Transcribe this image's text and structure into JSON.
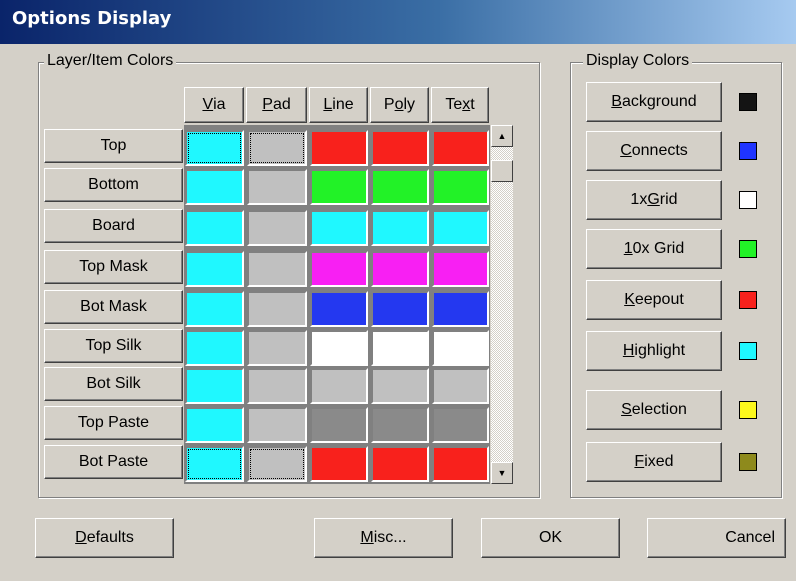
{
  "window": {
    "title": "Options Display"
  },
  "layer_group": {
    "title": "Layer/Item Colors",
    "columns": [
      {
        "pre": "",
        "ul": "V",
        "post": "ia"
      },
      {
        "pre": "",
        "ul": "P",
        "post": "ad"
      },
      {
        "pre": "",
        "ul": "L",
        "post": "ine"
      },
      {
        "pre": "P",
        "ul": "o",
        "post": "ly"
      },
      {
        "pre": "Te",
        "ul": "x",
        "post": "t"
      }
    ],
    "rows": [
      {
        "label": "Top",
        "colors": [
          "#1ff8ff",
          "#c0c0c0",
          "#f8211c",
          "#f8211c",
          "#f8211c"
        ]
      },
      {
        "label": "Bottom",
        "colors": [
          "#1ff8ff",
          "#c0c0c0",
          "#22f227",
          "#22f227",
          "#22f227"
        ]
      },
      {
        "label": "Board",
        "colors": [
          "#1ff8ff",
          "#c0c0c0",
          "#1ff8ff",
          "#1ff8ff",
          "#1ff8ff"
        ]
      },
      {
        "label": "Top Mask",
        "colors": [
          "#1ff8ff",
          "#c0c0c0",
          "#f81ff3",
          "#f81ff3",
          "#f81ff3"
        ]
      },
      {
        "label": "Bot Mask",
        "colors": [
          "#1ff8ff",
          "#c0c0c0",
          "#2438f0",
          "#2438f0",
          "#2438f0"
        ]
      },
      {
        "label": "Top Silk",
        "colors": [
          "#1ff8ff",
          "#c0c0c0",
          "#ffffff",
          "#ffffff",
          "#ffffff"
        ]
      },
      {
        "label": "Bot Silk",
        "colors": [
          "#1ff8ff",
          "#c0c0c0",
          "#c0c0c0",
          "#c0c0c0",
          "#c0c0c0"
        ]
      },
      {
        "label": "Top Paste",
        "colors": [
          "#1ff8ff",
          "#c0c0c0",
          "#8a8a8a",
          "#8a8a8a",
          "#8a8a8a"
        ]
      },
      {
        "label": "Bot Paste",
        "colors": [
          "#1ff8ff",
          "#c0c0c0",
          "#f8211c",
          "#f8211c",
          "#f8211c"
        ]
      }
    ]
  },
  "display_group": {
    "title": "Display Colors",
    "items": [
      {
        "pre": "",
        "ul": "B",
        "post": "ackground",
        "color": "#141414"
      },
      {
        "pre": "",
        "ul": "C",
        "post": "onnects",
        "color": "#1f34ff"
      },
      {
        "pre": "1x ",
        "ul": "G",
        "post": "rid",
        "color": "#ffffff"
      },
      {
        "pre": "",
        "ul": "1",
        "post": "0x Grid",
        "color": "#22f227"
      },
      {
        "pre": "",
        "ul": "K",
        "post": "eepout",
        "color": "#f8211c"
      },
      {
        "pre": "",
        "ul": "H",
        "post": "ighlight",
        "color": "#1ff8ff"
      },
      {
        "pre": "",
        "ul": "S",
        "post": "election",
        "color": "#fcf81c"
      },
      {
        "pre": "",
        "ul": "F",
        "post": "ixed",
        "color": "#8e8a1c"
      }
    ]
  },
  "footer": {
    "defaults": {
      "pre": "",
      "ul": "D",
      "post": "efaults"
    },
    "misc": {
      "pre": "",
      "ul": "M",
      "post": "isc..."
    },
    "ok": "OK",
    "cancel": "Cancel"
  },
  "scrollbar": {
    "up_icon": "arrow-up-icon",
    "down_icon": "arrow-down-icon"
  }
}
